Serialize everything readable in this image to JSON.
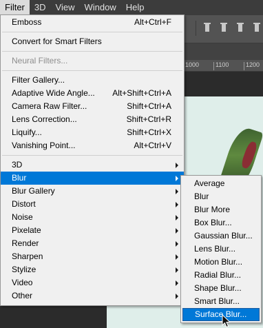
{
  "menubar": {
    "items": [
      "Filter",
      "3D",
      "View",
      "Window",
      "Help"
    ],
    "active_index": 0
  },
  "ruler": {
    "ticks": [
      "1000",
      "1100",
      "1200"
    ]
  },
  "filter_menu": {
    "items": [
      {
        "label": "Emboss",
        "shortcut": "Alt+Ctrl+F"
      },
      {
        "label": "Convert for Smart Filters"
      },
      {
        "label": "Neural Filters...",
        "disabled": true
      },
      {
        "label": "Filter Gallery..."
      },
      {
        "label": "Adaptive Wide Angle...",
        "shortcut": "Alt+Shift+Ctrl+A"
      },
      {
        "label": "Camera Raw Filter...",
        "shortcut": "Shift+Ctrl+A"
      },
      {
        "label": "Lens Correction...",
        "shortcut": "Shift+Ctrl+R"
      },
      {
        "label": "Liquify...",
        "shortcut": "Shift+Ctrl+X"
      },
      {
        "label": "Vanishing Point...",
        "shortcut": "Alt+Ctrl+V"
      },
      {
        "label": "3D"
      },
      {
        "label": "Blur",
        "highlighted": true
      },
      {
        "label": "Blur Gallery"
      },
      {
        "label": "Distort"
      },
      {
        "label": "Noise"
      },
      {
        "label": "Pixelate"
      },
      {
        "label": "Render"
      },
      {
        "label": "Sharpen"
      },
      {
        "label": "Stylize"
      },
      {
        "label": "Video"
      },
      {
        "label": "Other"
      }
    ]
  },
  "blur_menu": {
    "items": [
      "Average",
      "Blur",
      "Blur More",
      "Box Blur...",
      "Gaussian Blur...",
      "Lens Blur...",
      "Motion Blur...",
      "Radial Blur...",
      "Shape Blur...",
      "Smart Blur...",
      "Surface Blur..."
    ],
    "highlighted_index": 10
  },
  "colors": {
    "highlight": "#0078d7",
    "menu_bg": "#f0f0f0",
    "menubar_bg": "#3c3c3c"
  }
}
